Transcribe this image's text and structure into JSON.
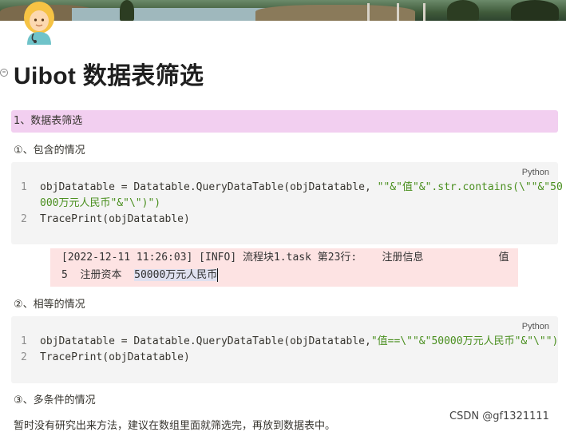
{
  "title": "Uibot 数据表筛选",
  "section1_heading": "1、数据表筛选",
  "sub1": "①、包含的情况",
  "code1": {
    "lang": "Python",
    "lines": [
      {
        "num": "1",
        "code": "objDatatable = Datatable.QueryDataTable(objDatatable, ",
        "str": "\"\"&\"值\"&\".str.contains(\\\"\"&\"50"
      },
      {
        "num": "",
        "code": "",
        "str": "000万元人民币\"&\"\\\")\")"
      },
      {
        "num": "2",
        "code": "TracePrint(objDatatable)",
        "str": ""
      }
    ]
  },
  "console": {
    "line1": "[2022-12-11 11:26:03] [INFO] 流程块1.task 第23行:    注册信息            值",
    "line2_prefix": "5  注册资本  ",
    "line2_highlight": "50000万元人民币"
  },
  "sub2": "②、相等的情况",
  "code2": {
    "lang": "Python",
    "lines": [
      {
        "num": "1",
        "code": "objDatatable = Datatable.QueryDataTable(objDatatable,",
        "str": "\"值==\\\"\"&\"50000万元人民币\"&\"\\\"\")"
      },
      {
        "num": "2",
        "code": "TracePrint(objDatatable)",
        "str": ""
      }
    ]
  },
  "sub3": "③、多条件的情况",
  "note": "暂时没有研究出来方法，建议在数组里面就筛选完，再放到数据表中。",
  "watermark": "CSDN @gf1321111",
  "colors": {
    "heading_bg": "#f2cff0",
    "code_bg": "#f4f4f4",
    "console_bg": "#fde3e3",
    "string": "#4a8f1f"
  }
}
